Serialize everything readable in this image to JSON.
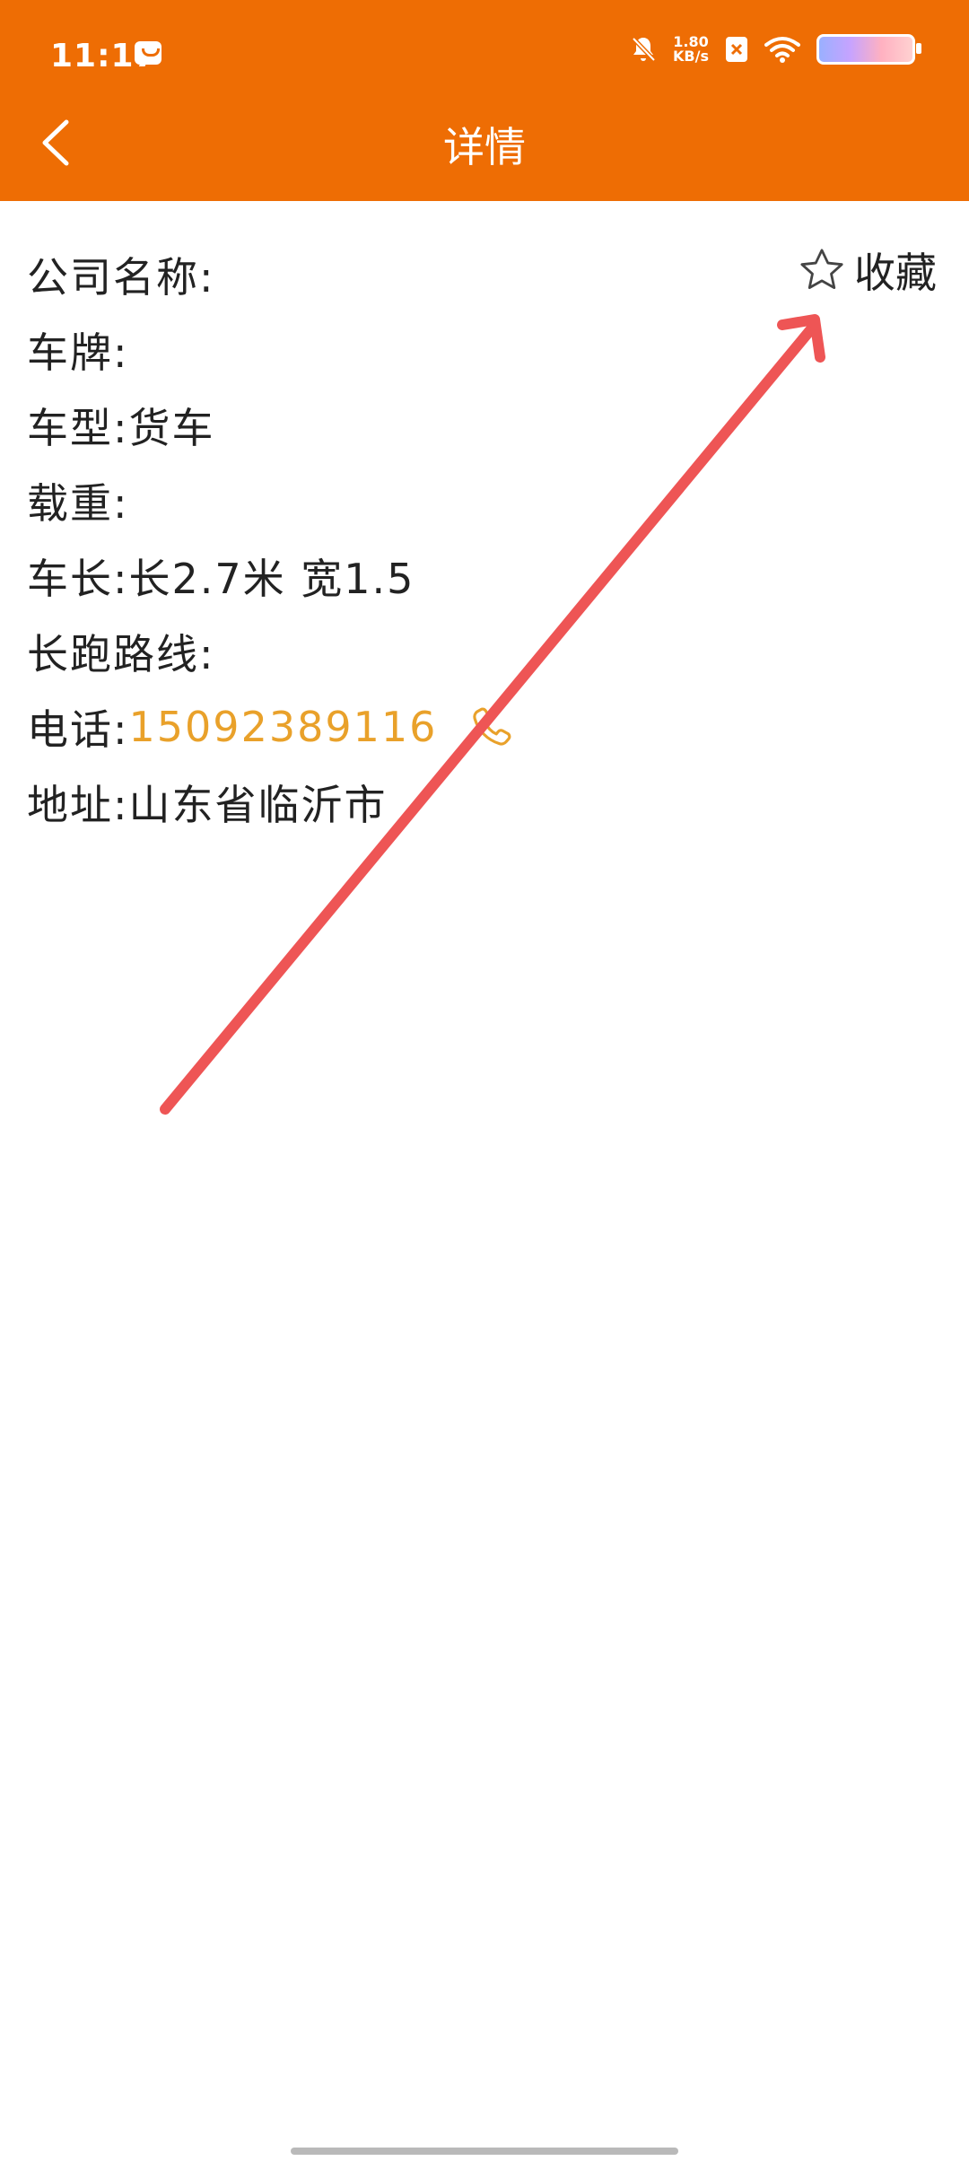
{
  "status": {
    "time": "11:17",
    "net_speed_value": "1.80",
    "net_speed_unit": "KB/s"
  },
  "header": {
    "title": "详情"
  },
  "favorite": {
    "label": "收藏"
  },
  "details": {
    "company_label": "公司名称:",
    "plate_label": "车牌:",
    "type_label": "车型:",
    "type_value": "货车",
    "load_label": "载重:",
    "length_label": "车长:",
    "length_value": "长2.7米 宽1.5",
    "route_label": "长跑路线:",
    "phone_label": "电话:",
    "phone_value": "15092389116",
    "address_label": "地址:",
    "address_value": "山东省临沂市"
  },
  "colors": {
    "header_bg": "#ee6d04",
    "phone_text": "#e9a12a",
    "annotation_arrow": "#ee5555"
  },
  "icons": {
    "back": "chevron-left-icon",
    "favorite": "star-outline-icon",
    "phone": "phone-icon"
  }
}
